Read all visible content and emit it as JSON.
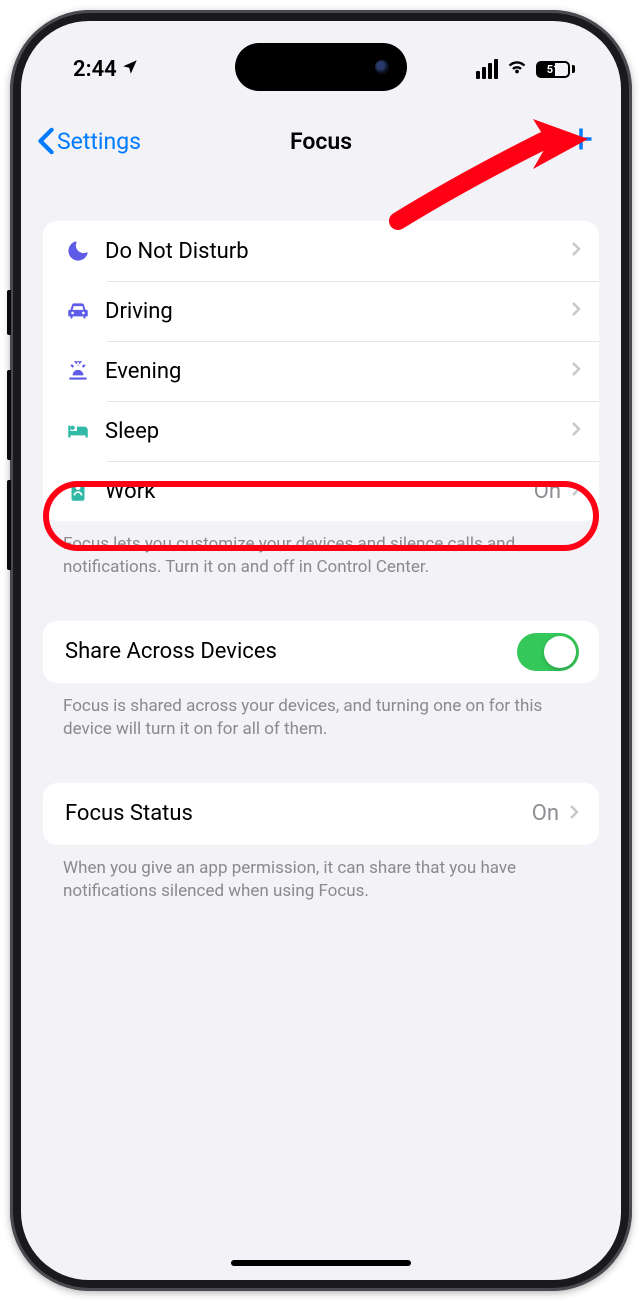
{
  "status": {
    "time": "2:44",
    "battery_pct": "51"
  },
  "nav": {
    "back_label": "Settings",
    "title": "Focus"
  },
  "focus_modes": [
    {
      "icon": "moon",
      "label": "Do Not Disturb",
      "value": "",
      "color": "#5e5ce6"
    },
    {
      "icon": "car",
      "label": "Driving",
      "value": "",
      "color": "#5e5ce6"
    },
    {
      "icon": "sunset",
      "label": "Evening",
      "value": "",
      "color": "#5e5ce6"
    },
    {
      "icon": "bed",
      "label": "Sleep",
      "value": "",
      "color": "#2fb9a6"
    },
    {
      "icon": "badge",
      "label": "Work",
      "value": "On",
      "color": "#2fb9a6"
    }
  ],
  "focus_footer": "Focus lets you customize your devices and silence calls and notifications. Turn it on and off in Control Center.",
  "share": {
    "label": "Share Across Devices",
    "footer": "Focus is shared across your devices, and turning one on for this device will turn it on for all of them."
  },
  "status_row": {
    "label": "Focus Status",
    "value": "On",
    "footer": "When you give an app permission, it can share that you have notifications silenced when using Focus."
  },
  "annotation": {
    "highlight_row_index": 4,
    "arrow_target": "add-button"
  }
}
